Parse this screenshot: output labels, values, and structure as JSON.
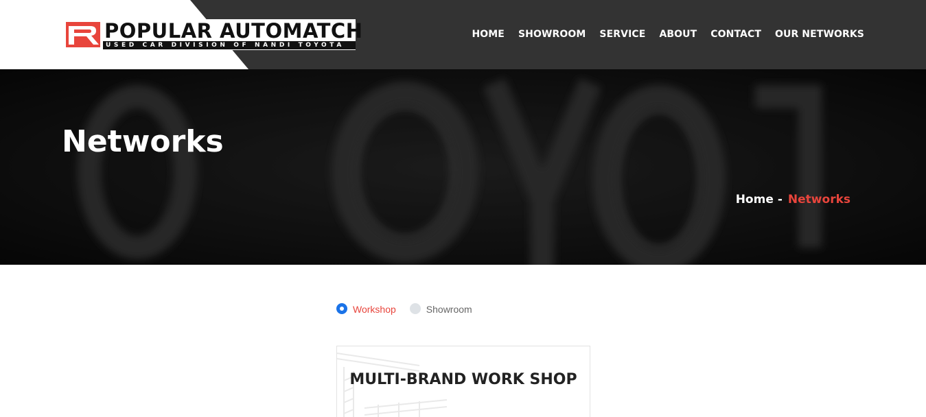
{
  "header": {
    "logo_text": "POPULAR AUTOMATCH",
    "logo_subtitle": "USED CAR DIVISION OF NANDI TOYOTA",
    "nav": [
      {
        "label": "HOME"
      },
      {
        "label": "SHOWROOM"
      },
      {
        "label": "SERVICE"
      },
      {
        "label": "ABOUT"
      },
      {
        "label": "CONTACT"
      },
      {
        "label": "OUR NETWORKS"
      }
    ]
  },
  "banner": {
    "title": "Networks",
    "breadcrumb": {
      "home": "Home",
      "separator": "-",
      "current": "Networks"
    }
  },
  "filters": {
    "options": [
      {
        "label": "Workshop",
        "selected": true
      },
      {
        "label": "Showroom",
        "selected": false
      }
    ]
  },
  "card": {
    "title": "MULTI-BRAND WORK SHOP"
  },
  "colors": {
    "header_bg": "#333333",
    "accent_red": "#e8453c",
    "radio_blue": "#1a73e8"
  }
}
